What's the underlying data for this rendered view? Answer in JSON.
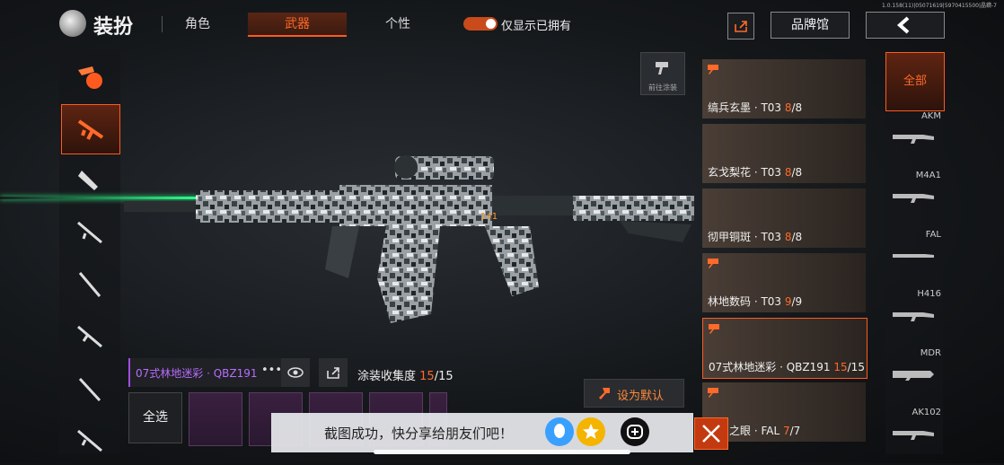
{
  "version": "1.0.158(11)|05071619|5970415500|晶鑽-7",
  "header": {
    "title": "装扮",
    "tabs": [
      {
        "label": "角色",
        "active": false
      },
      {
        "label": "武器",
        "active": true
      },
      {
        "label": "个性",
        "active": false
      }
    ],
    "toggle_label": "仅显示已拥有",
    "toggle_on": true,
    "brand_label": "品牌馆"
  },
  "left_sidebar": {
    "items": [
      "weapon-skin-icon",
      "assault-rifle-icon",
      "smg-icon",
      "sniper-rifle-icon",
      "marksman-rifle-icon",
      "rifle-icon",
      "shotgun-icon",
      "pistol-icon"
    ],
    "selected_index": 1
  },
  "coating_button_label": "前往涂装",
  "info": {
    "weapon_name": "07式林地迷彩 · QBZ191",
    "more": "•••",
    "collect_label": "涂装收集度",
    "collect_current": "15",
    "collect_total": "/15",
    "set_default": "设为默认",
    "select_all": "全选"
  },
  "skins": [
    {
      "name": "缟兵玄墨 · T03",
      "owned": "8",
      "total": "/8"
    },
    {
      "name": "玄戈梨花 · T03",
      "owned": "8",
      "total": "/8"
    },
    {
      "name": "彻甲铜斑 · T03",
      "owned": "8",
      "total": "/8"
    },
    {
      "name": "林地数码 · T03",
      "owned": "9",
      "total": "/9"
    },
    {
      "name": "07式林地迷彩 · QBZ191",
      "owned": "15",
      "total": "/15"
    },
    {
      "name": "之眼 · FAL",
      "owned": "7",
      "total": "/7"
    }
  ],
  "categories": {
    "all_label": "全部",
    "items": [
      "AKM",
      "M4A1",
      "FAL",
      "H416",
      "MDR",
      "AK102"
    ]
  },
  "toast": {
    "message": "截图成功，快分享给朋友们吧！"
  },
  "colors": {
    "accent": "#ff5a1e",
    "purple": "#b86cff",
    "laser": "#2dff8a"
  }
}
